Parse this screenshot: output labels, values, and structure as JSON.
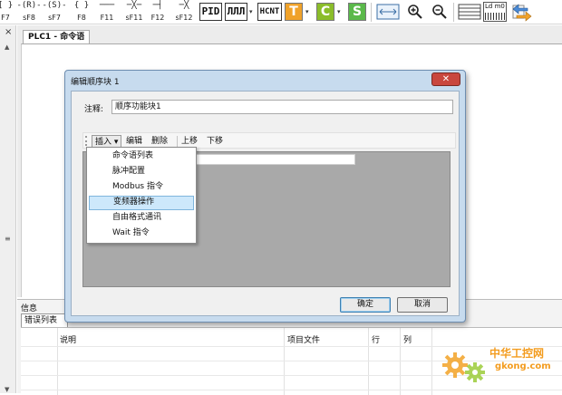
{
  "toolbar": {
    "ladder_symbols": [
      {
        "glyph": "[ }",
        "key": "F7"
      },
      {
        "glyph": "-(R)-",
        "key": "sF8"
      },
      {
        "glyph": "-(S)-",
        "key": "sF7"
      },
      {
        "glyph": "{  }",
        "key": "F8"
      },
      {
        "glyph": "───",
        "key": "F11"
      },
      {
        "glyph": "─╳─",
        "key": "sF11"
      },
      {
        "glyph": "─┤",
        "key": "F12"
      },
      {
        "glyph": "─╳",
        "key": "sF12"
      }
    ],
    "pid_label": "PID",
    "pulse_label": "ЛЛЛ",
    "hcnt_label": "HCNT",
    "t_label": "T",
    "c_label": "C",
    "s_label": "S",
    "ld_label": "Ld m0",
    "colors": {
      "t": "#f0a22a",
      "c": "#8bbd2a",
      "s": "#5ab94a"
    }
  },
  "left_strip": {
    "close_glyph": "×",
    "up_glyph": "▲",
    "mid_glyph": "≡",
    "down_glyph": "▼"
  },
  "main": {
    "tab_label": "PLC1 - 命令语"
  },
  "dialog": {
    "title": "编辑顺序块 1",
    "close_glyph": "✕",
    "comment_label": "注释:",
    "comment_value": "顺序功能块1",
    "toolbar": {
      "insert": "插入",
      "insert_caret": "▾",
      "edit": "编辑",
      "delete": "删除",
      "move_up": "上移",
      "move_down": "下移"
    },
    "ok": "确定",
    "cancel": "取消"
  },
  "insert_menu": {
    "items": [
      {
        "label": "命令语列表",
        "active": false
      },
      {
        "label": "脉冲配置",
        "active": false
      },
      {
        "label": "Modbus 指令",
        "active": false
      },
      {
        "label": "变频器操作",
        "active": true
      },
      {
        "label": "自由格式通讯",
        "active": false
      },
      {
        "label": "Wait 指令",
        "active": false
      }
    ]
  },
  "bottom": {
    "info_label": "信息",
    "error_tab": "错误列表",
    "columns": [
      "说明",
      "项目文件",
      "行",
      "列"
    ]
  },
  "watermark": {
    "cn": "中华工控网",
    "en": "gkong.com"
  }
}
